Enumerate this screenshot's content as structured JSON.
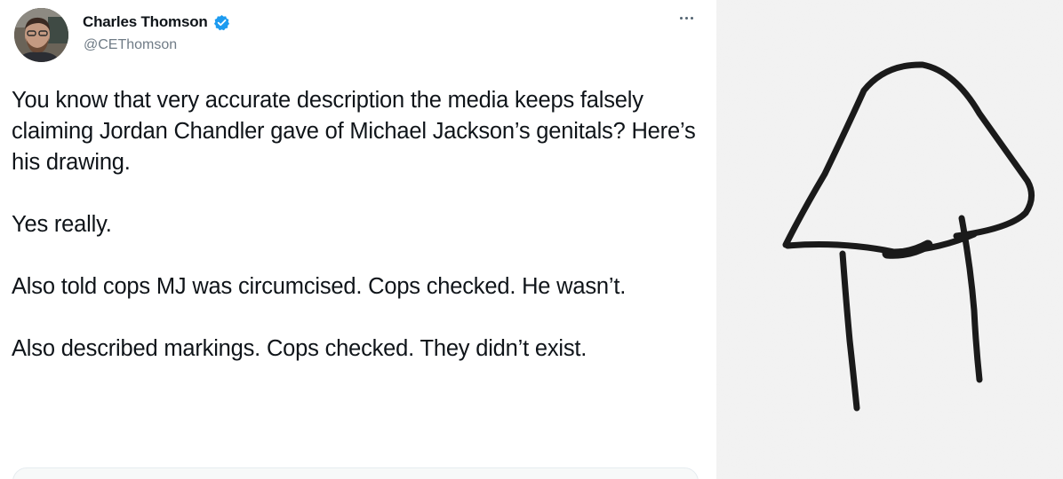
{
  "tweet": {
    "author": {
      "name": "Charles Thomson",
      "handle": "@CEThomson",
      "verified": true,
      "avatar_icon": "person-avatar-icon"
    },
    "more_icon": "more-options-icon",
    "paragraphs": [
      "You know that very accurate description the media keeps falsely claiming Jordan Chandler gave of Michael Jackson’s genitals? Here’s his drawing.",
      "Yes really.",
      "Also told cops MJ was circumcised. Cops checked. He wasn’t.",
      "Also described markings. Cops checked. They didn’t exist."
    ]
  },
  "colors": {
    "text": "#0f1419",
    "secondary_text": "#6f7b86",
    "verified_badge": "#1d9bf0",
    "drawing_background": "#f1f1f1",
    "ink": "#1a1a1a"
  },
  "drawing": {
    "description_icon": "hand-drawn-sketch-image"
  }
}
